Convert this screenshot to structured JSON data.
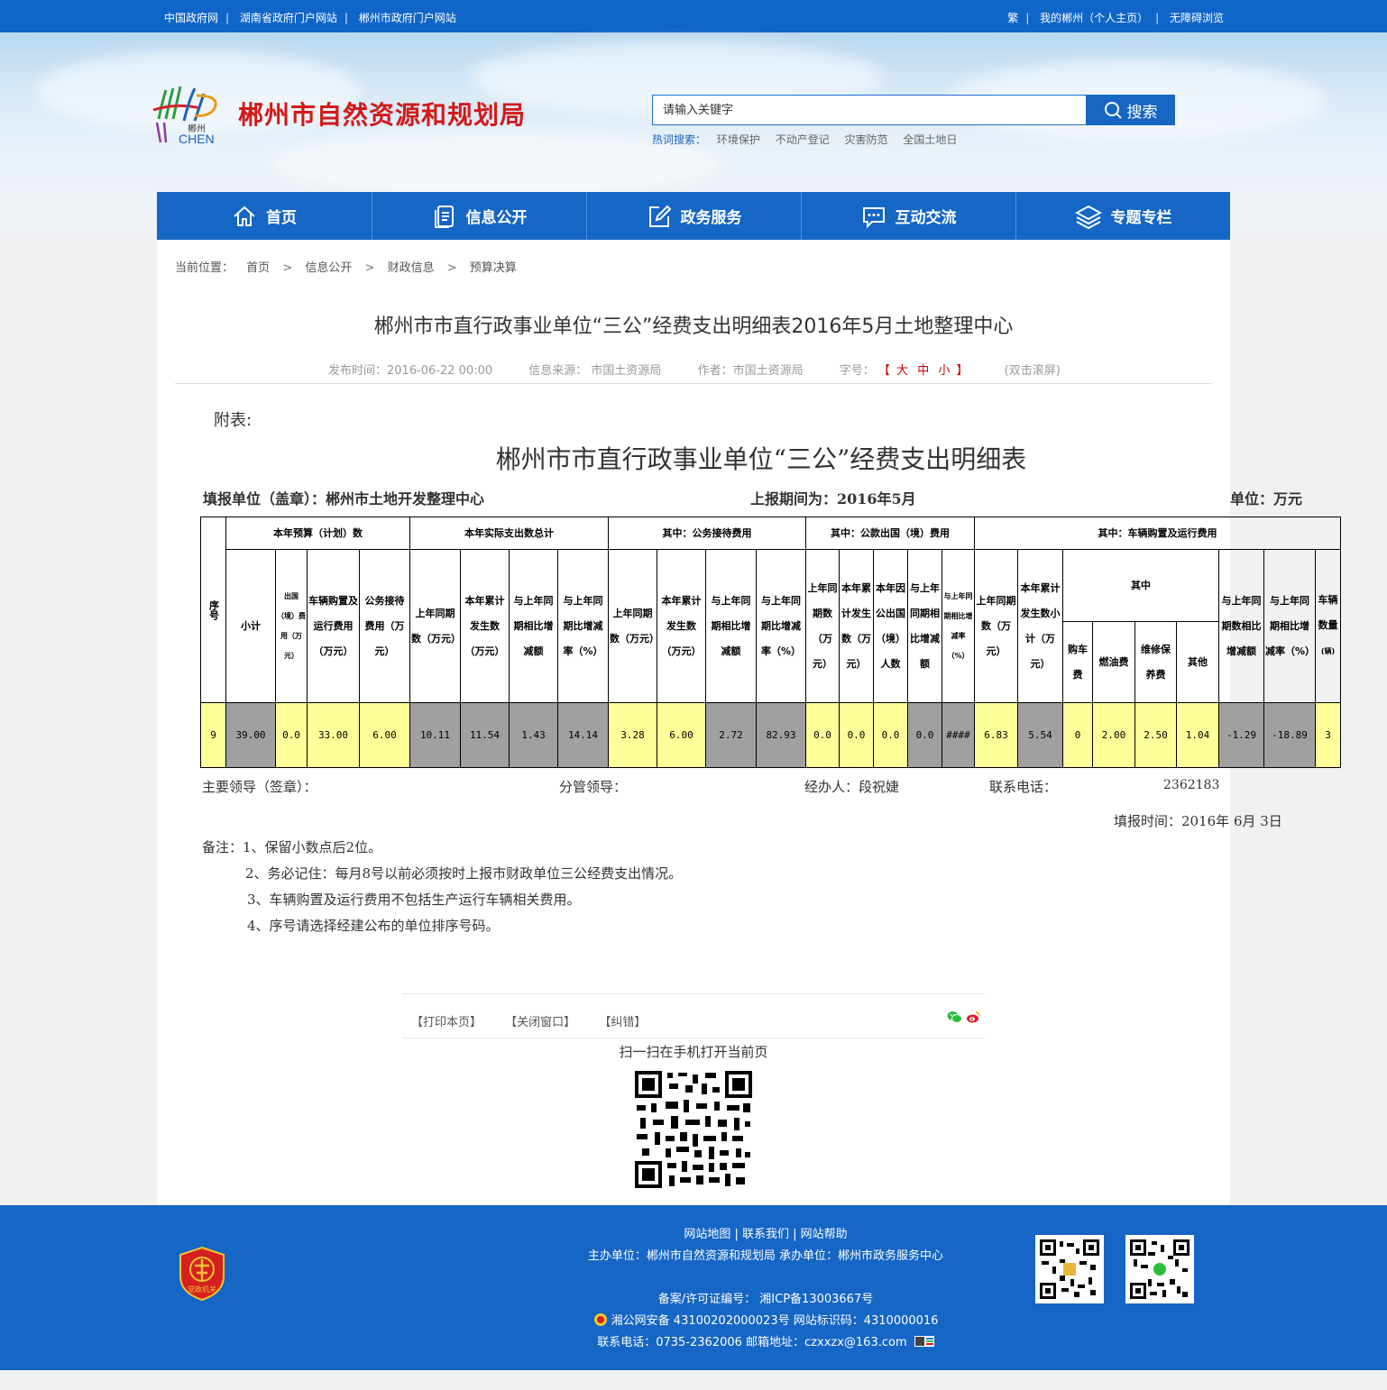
{
  "topbar": {
    "left_links": [
      "中国政府网",
      "湖南省政府门户网站",
      "郴州市政府门户网站"
    ],
    "right_links": [
      "繁",
      "我的郴州（个人主页）",
      "无障碍浏览"
    ]
  },
  "header": {
    "logo_text_top": "郴州",
    "logo_text_bottom": "CHEN",
    "site_title": "郴州市自然资源和规划局",
    "search_placeholder": "请输入关键字",
    "search_button": "搜索",
    "hot_label": "热词搜索：",
    "hot_words": [
      "环境保护",
      "不动产登记",
      "灾害防范",
      "全国土地日"
    ]
  },
  "nav": {
    "items": [
      {
        "label": "首页",
        "icon": "home-icon"
      },
      {
        "label": "信息公开",
        "icon": "document-icon"
      },
      {
        "label": "政务服务",
        "icon": "edit-icon"
      },
      {
        "label": "互动交流",
        "icon": "chat-icon"
      },
      {
        "label": "专题专栏",
        "icon": "layers-icon"
      }
    ]
  },
  "breadcrumb": {
    "label": "当前位置：",
    "items": [
      "首页",
      "信息公开",
      "财政信息",
      "预算决算"
    ],
    "separator": ">"
  },
  "article": {
    "title": "郴州市市直行政事业单位“三公”经费支出明细表2016年5月土地整理中心",
    "publish_time": "发布时间：2016-06-22 00:00",
    "source": "信息来源： 市国土资源局",
    "author": "作者：市国土资源局",
    "font_size_label": "字号：",
    "font_size_open": "【",
    "font_size_options": [
      "大",
      "中",
      "小"
    ],
    "font_size_close": "】",
    "scroll_hint": "(双击滚屏)"
  },
  "document": {
    "attach_label": "附表:",
    "table_title": "郴州市市直行政事业单位“三公”经费支出明细表",
    "unit_line": "填报单位（盖章）：郴州市土地开发整理中心",
    "period_line": "上报期间为：2016年5月",
    "currency_line": "单位：万元",
    "headers": {
      "seq": "序号",
      "g_budget": "本年预算（计划）数",
      "g_actual": "本年实际支出数总计",
      "g_reception": "其中：公务接待费用",
      "g_abroad": "其中：公款出国（境）费用",
      "g_vehicle": "其中：车辆购置及运行费用",
      "subtotal": "小计",
      "abroad_fee": "出国（境）费用（万元）",
      "vehicle_fee": "车辆购置及运行费用（万元）",
      "reception_fee": "公务接待费用（万元）",
      "a_last": "上年同期数（万元）",
      "a_cum": "本年累计发生数（万元）",
      "a_diff": "与上年同期相比增减额",
      "a_rate": "与上年同期比增减率（%）",
      "r_last": "上年同期数（万元）",
      "r_cum": "本年累计发生数（万元）",
      "r_diff": "与上年同期相比增减额",
      "r_rate": "与上年同期比增减率（%）",
      "o_last": "上年同期数（万元）",
      "o_cum": "本年累计发生数（万元）",
      "o_people": "本年因公出国（境）人数",
      "o_diff": "与上年同期相比增减额",
      "o_rate": "与上年同期相比增减率（%）",
      "v_last": "上年同期数（万元）",
      "v_sub": "本年累计发生数小计（万元）",
      "v_among": "其中",
      "v_buy": "购车费",
      "v_fuel": "燃油费",
      "v_maint": "维修保养费",
      "v_other": "其他",
      "v_diff": "与上年同期数相比增减额",
      "v_rate": "与上年同期相比增减率（%）",
      "v_count": "车辆数量",
      "v_count_unit": "(辆)"
    },
    "row": [
      "9",
      "39.00",
      "0.0",
      "33.00",
      "6.00",
      "10.11",
      "11.54",
      "1.43",
      "14.14",
      "3.28",
      "6.00",
      "2.72",
      "82.93",
      "0.0",
      "0.0",
      "0.0",
      "0.0",
      "####",
      "6.83",
      "5.54",
      "0",
      "2.00",
      "2.50",
      "1.04",
      "-1.29",
      "-18.89",
      "3"
    ],
    "sign_leader": "主要领导（签章）：",
    "sign_manager": "分管领导：",
    "sign_handler": "经办人：段祝婕",
    "sign_phone_label": "联系电话：",
    "sign_phone": "2362183",
    "fill_time": "填报时间：2016年  6月 3日",
    "notes": [
      "备注：1、保留小数点后2位。",
      "2、务必记住：每月8号以前必须按时上报市财政单位三公经费支出情况。",
      "3、车辆购置及运行费用不包括生产运行车辆相关费用。",
      "4、序号请选择经建公布的单位排序号码。"
    ]
  },
  "share": {
    "links": [
      "【打印本页】",
      "【关闭窗口】",
      "【纠错】"
    ],
    "qr_caption": "扫一扫在手机打开当前页"
  },
  "footer": {
    "links": "网站地图 | 联系我们 | 网站帮助",
    "host": "主办单位：郴州市自然资源和规划局   承办单位：郴州市政务服务中心",
    "icp": "备案/许可证编号： 湘ICP备13003667号",
    "police": "湘公网安备 43100202000023号   网站标识码：4310000016",
    "contact": "联系电话：0735-2362006   邮箱地址：czxxzx@163.com",
    "badge_text": "党政机关",
    "colors": {
      "primary": "#1566c5",
      "title_red": "#d11a1a"
    }
  }
}
